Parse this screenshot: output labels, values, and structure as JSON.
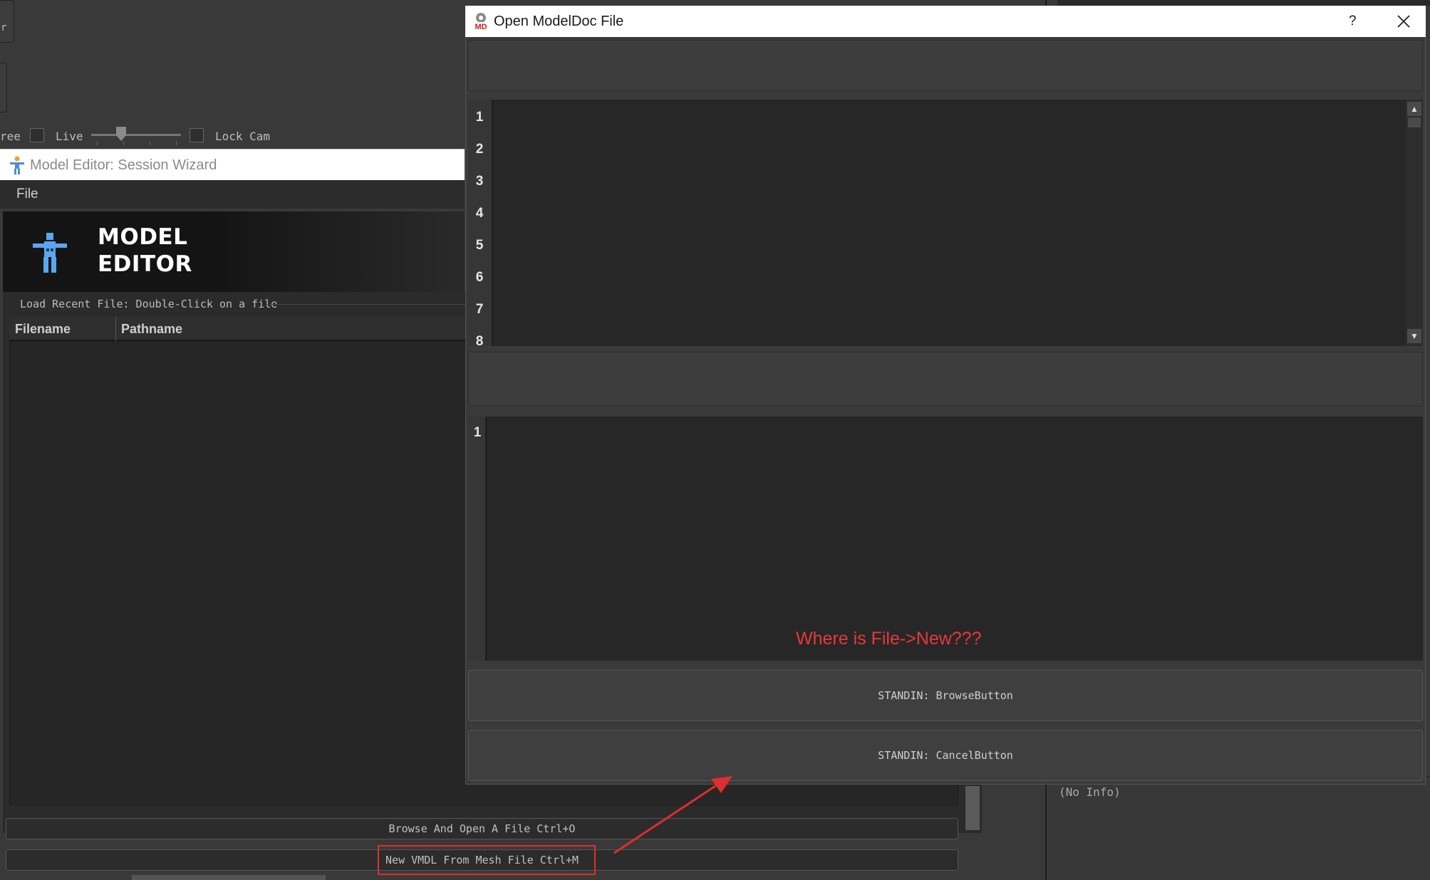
{
  "background": {
    "toolbar": {
      "partial_label": "ree",
      "live_label": "Live",
      "lock_cam_label": "Lock Cam"
    },
    "edge_char": "r",
    "info_text": "(No Info)"
  },
  "session_wizard": {
    "title": "Model Editor: Session Wizard",
    "menu": {
      "file": "File"
    },
    "logo": {
      "line1": "MODEL",
      "line2": "EDITOR"
    },
    "recent_label": "Load Recent File: Double-Click on a file",
    "table": {
      "columns": [
        "Filename",
        "Pathname"
      ],
      "rows": []
    },
    "buttons": {
      "browse": "Browse And Open A File Ctrl+O",
      "new_vmdl": "New VMDL From Mesh File Ctrl+M"
    }
  },
  "dialog": {
    "title": "Open ModelDoc File",
    "help": "?",
    "icon_text": "MD",
    "top_editor_lines": [
      "1",
      "2",
      "3",
      "4",
      "5",
      "6",
      "7",
      "8"
    ],
    "bottom_editor_lines": [
      "1"
    ],
    "browse_button": "STANDIN: BrowseButton",
    "cancel_button": "STANDIN: CancelButton"
  },
  "annotation": {
    "text": "Where is File->New???",
    "color": "#e8383b"
  },
  "colors": {
    "dialog_bg": "#3a3a3a",
    "editor_bg": "#272727",
    "annotation_red": "#e02d2d",
    "figure_blue": "#5aa6f0"
  }
}
